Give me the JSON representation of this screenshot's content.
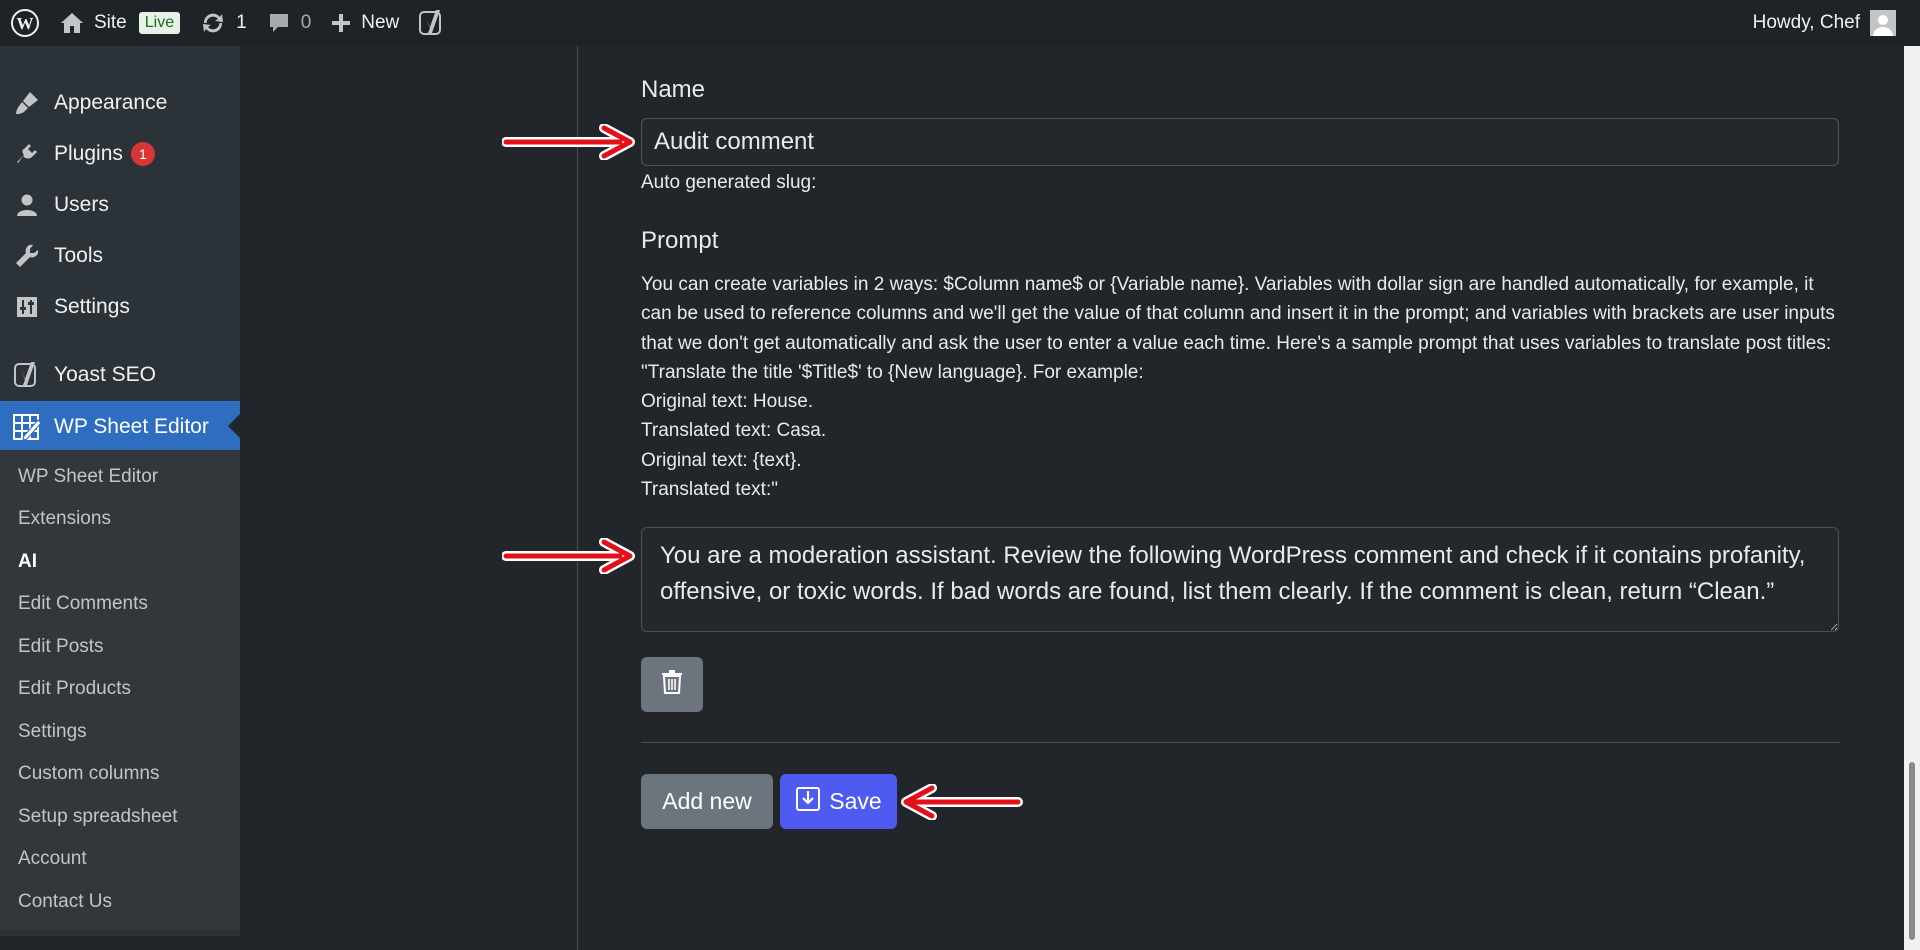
{
  "adminbar": {
    "site_label": "Site",
    "live_label": "Live",
    "updates_count": "1",
    "comments_count": "0",
    "new_label": "New",
    "howdy": "Howdy, Chef"
  },
  "sidebar": {
    "items": [
      {
        "label": "Appearance"
      },
      {
        "label": "Plugins",
        "badge": "1"
      },
      {
        "label": "Users"
      },
      {
        "label": "Tools"
      },
      {
        "label": "Settings"
      },
      {
        "label": "Yoast SEO"
      },
      {
        "label": "WP Sheet Editor"
      }
    ],
    "submenu": [
      "WP Sheet Editor",
      "Extensions",
      "AI",
      "Edit Comments",
      "Edit Posts",
      "Edit Products",
      "Settings",
      "Custom columns",
      "Setup spreadsheet",
      "Account",
      "Contact Us"
    ]
  },
  "form": {
    "name_label": "Name",
    "name_value": "Audit comment",
    "slug_label": "Auto generated slug:",
    "prompt_label": "Prompt",
    "help_lines": [
      "You can create variables in 2 ways: $Column name$ or {Variable name}. Variables with dollar sign are handled automatically, for example, it can be used to reference columns and we'll get the value of that column and insert it in the prompt; and variables with brackets are user inputs that we don't get automatically and ask the user to enter a value each time. Here's a sample prompt that uses variables to translate post titles: \"Translate the title '$Title$' to {New language}. For example:",
      "Original text: House.",
      "Translated text: Casa.",
      "Original text: {text}.",
      "Translated text:\""
    ],
    "prompt_value": "You are a moderation assistant. Review the following WordPress comment and check if it contains profanity, offensive, or toxic words. If bad words are found, list them clearly. If the comment is clean, return “Clean.”",
    "add_new_label": "Add new",
    "save_label": "Save"
  },
  "colors": {
    "accent": "#4f5bf0",
    "menu_current": "#2f6dc0",
    "annotation_arrow": "#e3101a"
  }
}
